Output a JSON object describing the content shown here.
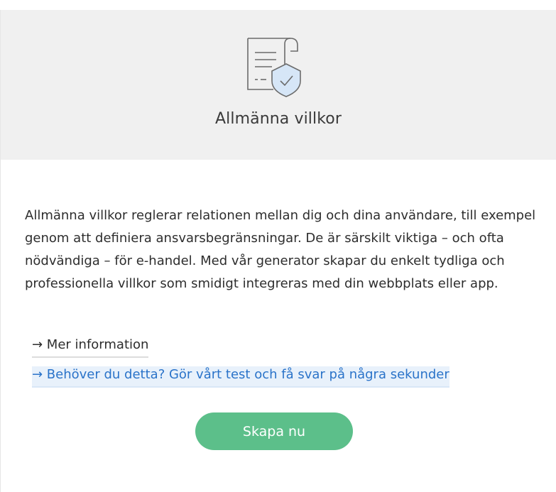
{
  "header": {
    "icon": "document-shield-icon",
    "title": "Allmänna villkor"
  },
  "content": {
    "description": "Allmänna villkor reglerar relationen mellan dig och dina användare, till exempel genom att definiera ansvarsbegränsningar. De är särskilt viktiga – och ofta nödvändiga – för e-handel. Med vår generator skapar du enkelt tydliga och professionella villkor som smidigt integreras med din webbplats eller app.",
    "links": {
      "more_info": "→ Mer information",
      "test": "→ Behöver du detta? Gör vårt test och få svar på några sekunder"
    },
    "cta_label": "Skapa nu"
  },
  "colors": {
    "header_bg": "#f0f0f0",
    "link_blue": "#2a73c9",
    "cta_green": "#5cbf8a"
  }
}
